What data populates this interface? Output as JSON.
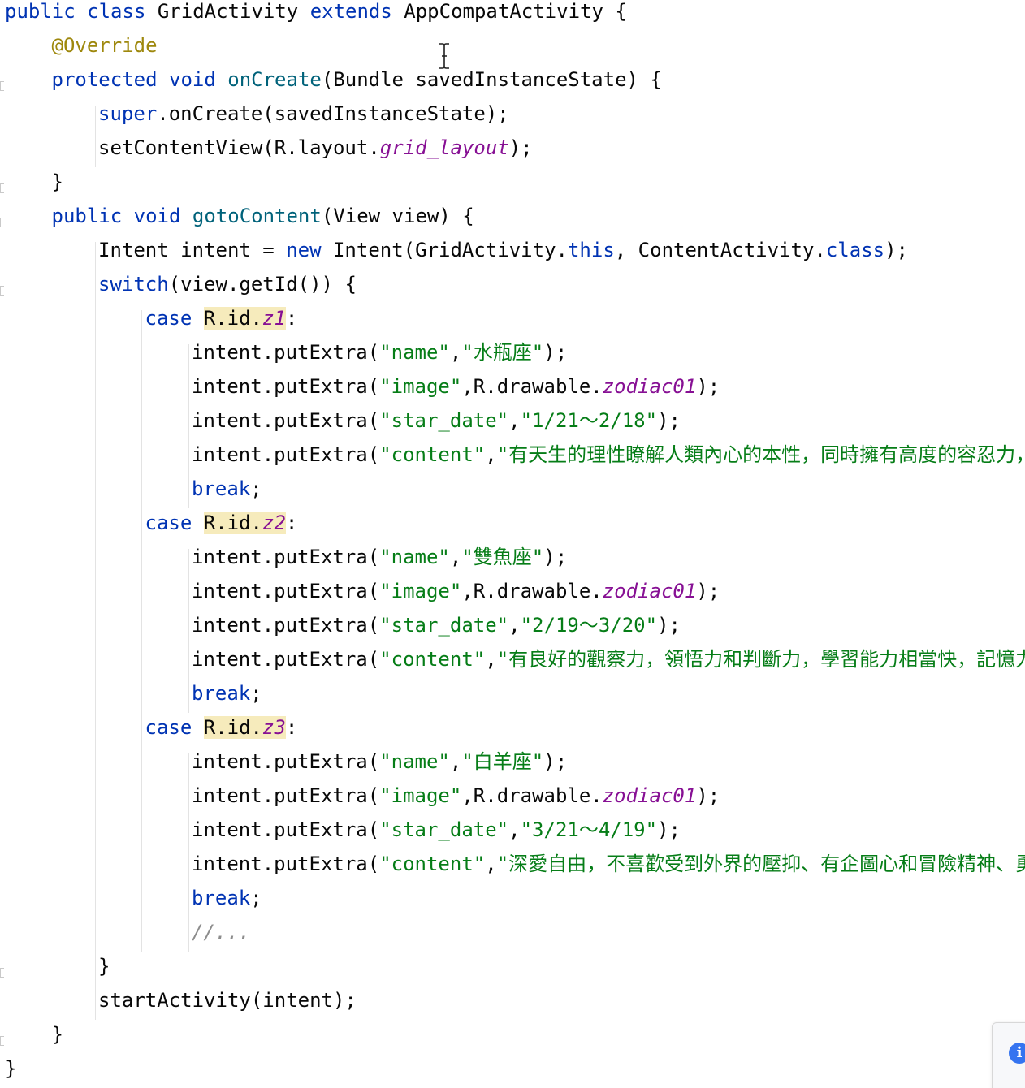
{
  "editor": {
    "lines": [
      {
        "indent": 0,
        "tokens": [
          [
            "public class ",
            "kw"
          ],
          [
            "GridActivity ",
            "pl"
          ],
          [
            "extends ",
            "kw"
          ],
          [
            "AppCompatActivity {",
            "pl"
          ]
        ]
      },
      {
        "indent": 1,
        "tokens": [
          [
            "@Override",
            "ann"
          ]
        ]
      },
      {
        "indent": 1,
        "tokens": [
          [
            "protected void ",
            "kw"
          ],
          [
            "onCreate",
            "fn"
          ],
          [
            "(Bundle savedInstanceState) {",
            "pl"
          ]
        ]
      },
      {
        "indent": 2,
        "tokens": [
          [
            "super",
            "kw"
          ],
          [
            ".onCreate(savedInstanceState);",
            "pl"
          ]
        ]
      },
      {
        "indent": 2,
        "tokens": [
          [
            "setContentView(R.layout.",
            "pl"
          ],
          [
            "grid_layout",
            "st"
          ],
          [
            ");",
            "pl"
          ]
        ]
      },
      {
        "indent": 1,
        "tokens": [
          [
            "}",
            "pl"
          ]
        ]
      },
      {
        "indent": 1,
        "tokens": [
          [
            "public void ",
            "kw"
          ],
          [
            "gotoContent",
            "fn"
          ],
          [
            "(View view) {",
            "pl"
          ]
        ]
      },
      {
        "indent": 2,
        "tokens": [
          [
            "Intent intent = ",
            "pl"
          ],
          [
            "new ",
            "kw"
          ],
          [
            "Intent(GridActivity.",
            "pl"
          ],
          [
            "this",
            "kw"
          ],
          [
            ", ContentActivity.",
            "pl"
          ],
          [
            "class",
            "kw"
          ],
          [
            ");",
            "pl"
          ]
        ]
      },
      {
        "indent": 2,
        "tokens": [
          [
            "switch",
            "kw"
          ],
          [
            "(view.getId()) {",
            "pl"
          ]
        ]
      },
      {
        "indent": 3,
        "tokens": [
          [
            "case ",
            "kw"
          ],
          [
            "R.id.",
            "hl"
          ],
          [
            "z1",
            "st hl"
          ],
          [
            ":",
            "pl"
          ]
        ]
      },
      {
        "indent": 4,
        "tokens": [
          [
            "intent.putExtra(",
            "pl"
          ],
          [
            "\"name\"",
            "str"
          ],
          [
            ",",
            "pl"
          ],
          [
            "\"水瓶座\"",
            "str"
          ],
          [
            ");",
            "pl"
          ]
        ]
      },
      {
        "indent": 4,
        "tokens": [
          [
            "intent.putExtra(",
            "pl"
          ],
          [
            "\"image\"",
            "str"
          ],
          [
            ",R.drawable.",
            "pl"
          ],
          [
            "zodiac01",
            "st"
          ],
          [
            ");",
            "pl"
          ]
        ]
      },
      {
        "indent": 4,
        "tokens": [
          [
            "intent.putExtra(",
            "pl"
          ],
          [
            "\"star_date\"",
            "str"
          ],
          [
            ",",
            "pl"
          ],
          [
            "\"1/21～2/18\"",
            "str"
          ],
          [
            ");",
            "pl"
          ]
        ]
      },
      {
        "indent": 4,
        "tokens": [
          [
            "intent.putExtra(",
            "pl"
          ],
          [
            "\"content\"",
            "str"
          ],
          [
            ",",
            "pl"
          ],
          [
            "\"有天生的理性瞭解人類內心的本性，同時擁有高度的容忍力，",
            "str"
          ]
        ]
      },
      {
        "indent": 4,
        "tokens": [
          [
            "break",
            "kw"
          ],
          [
            ";",
            "pl"
          ]
        ]
      },
      {
        "indent": 3,
        "tokens": [
          [
            "case ",
            "kw"
          ],
          [
            "R.id.",
            "hl"
          ],
          [
            "z2",
            "st hl"
          ],
          [
            ":",
            "pl"
          ]
        ]
      },
      {
        "indent": 4,
        "tokens": [
          [
            "intent.putExtra(",
            "pl"
          ],
          [
            "\"name\"",
            "str"
          ],
          [
            ",",
            "pl"
          ],
          [
            "\"雙魚座\"",
            "str"
          ],
          [
            ");",
            "pl"
          ]
        ]
      },
      {
        "indent": 4,
        "tokens": [
          [
            "intent.putExtra(",
            "pl"
          ],
          [
            "\"image\"",
            "str"
          ],
          [
            ",R.drawable.",
            "pl"
          ],
          [
            "zodiac01",
            "st"
          ],
          [
            ");",
            "pl"
          ]
        ]
      },
      {
        "indent": 4,
        "tokens": [
          [
            "intent.putExtra(",
            "pl"
          ],
          [
            "\"star_date\"",
            "str"
          ],
          [
            ",",
            "pl"
          ],
          [
            "\"2/19～3/20\"",
            "str"
          ],
          [
            ");",
            "pl"
          ]
        ]
      },
      {
        "indent": 4,
        "tokens": [
          [
            "intent.putExtra(",
            "pl"
          ],
          [
            "\"content\"",
            "str"
          ],
          [
            ",",
            "pl"
          ],
          [
            "\"有良好的觀察力，領悟力和判斷力，學習能力相當快，記憶力",
            "str"
          ]
        ]
      },
      {
        "indent": 4,
        "tokens": [
          [
            "break",
            "kw"
          ],
          [
            ";",
            "pl"
          ]
        ]
      },
      {
        "indent": 3,
        "tokens": [
          [
            "case ",
            "kw"
          ],
          [
            "R.id.",
            "hl"
          ],
          [
            "z3",
            "st hl"
          ],
          [
            ":",
            "pl"
          ]
        ]
      },
      {
        "indent": 4,
        "tokens": [
          [
            "intent.putExtra(",
            "pl"
          ],
          [
            "\"name\"",
            "str"
          ],
          [
            ",",
            "pl"
          ],
          [
            "\"白羊座\"",
            "str"
          ],
          [
            ");",
            "pl"
          ]
        ]
      },
      {
        "indent": 4,
        "tokens": [
          [
            "intent.putExtra(",
            "pl"
          ],
          [
            "\"image\"",
            "str"
          ],
          [
            ",R.drawable.",
            "pl"
          ],
          [
            "zodiac01",
            "st"
          ],
          [
            ");",
            "pl"
          ]
        ]
      },
      {
        "indent": 4,
        "tokens": [
          [
            "intent.putExtra(",
            "pl"
          ],
          [
            "\"star_date\"",
            "str"
          ],
          [
            ",",
            "pl"
          ],
          [
            "\"3/21～4/19\"",
            "str"
          ],
          [
            ");",
            "pl"
          ]
        ]
      },
      {
        "indent": 4,
        "tokens": [
          [
            "intent.putExtra(",
            "pl"
          ],
          [
            "\"content\"",
            "str"
          ],
          [
            ",",
            "pl"
          ],
          [
            "\"深愛自由，不喜歡受到外界的壓抑、有企圖心和冒險精神、勇",
            "str"
          ]
        ]
      },
      {
        "indent": 4,
        "tokens": [
          [
            "break",
            "kw"
          ],
          [
            ";",
            "pl"
          ]
        ]
      },
      {
        "indent": 4,
        "tokens": [
          [
            "//...",
            "cm"
          ]
        ]
      },
      {
        "indent": 2,
        "tokens": [
          [
            "}",
            "pl"
          ]
        ]
      },
      {
        "indent": 2,
        "tokens": [
          [
            "startActivity(intent);",
            "pl"
          ]
        ]
      },
      {
        "indent": 1,
        "tokens": [
          [
            "}",
            "pl"
          ]
        ]
      },
      {
        "indent": 0,
        "tokens": [
          [
            "}",
            "pl"
          ]
        ]
      }
    ]
  },
  "colors": {
    "keyword": "#0033b3",
    "method": "#00627a",
    "string": "#067d17",
    "annotation": "#9e880d",
    "static_field": "#871094",
    "comment": "#8c8c8c",
    "highlight": "#f6ebbc",
    "info_badge": "#3574f0"
  },
  "icons": {
    "cursor": "text-cursor-icon",
    "notification": "info-icon"
  },
  "notification": {
    "glyph": "i"
  }
}
